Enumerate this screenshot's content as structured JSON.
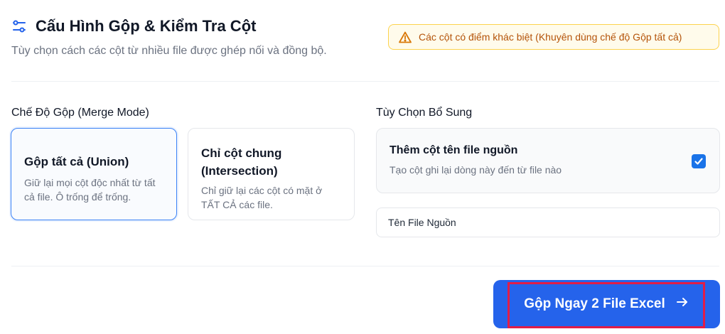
{
  "header": {
    "title": "Cấu Hình Gộp & Kiểm Tra Cột",
    "subtitle": "Tùy chọn cách các cột từ nhiều file được ghép nối và đồng bộ.",
    "warning": "Các cột có điểm khác biệt (Khuyên dùng chế độ Gộp tất cả)",
    "icons": {
      "title": "sliders-icon",
      "warning": "warning-triangle-icon"
    }
  },
  "merge_mode": {
    "label": "Chế Độ Gộp (Merge Mode)",
    "options": [
      {
        "title": "Gộp tất cả (Union)",
        "desc": "Giữ lại mọi cột độc nhất từ tất cả file. Ô trống để trống.",
        "selected": true
      },
      {
        "title": "Chỉ cột chung (Intersection)",
        "desc": "Chỉ giữ lại các cột có mặt ở TẤT CẢ các file.",
        "selected": false
      }
    ]
  },
  "extra_options": {
    "label": "Tùy Chọn Bổ Sung",
    "source_column": {
      "title": "Thêm cột tên file nguồn",
      "desc": "Tạo cột ghi lại dòng này đến từ file nào",
      "checked": true
    },
    "source_name_input": {
      "value": "Tên File Nguồn"
    }
  },
  "action": {
    "button_label": "Gộp Ngay 2 File Excel",
    "icon": "arrow-right-icon"
  },
  "colors": {
    "primary": "#2563eb",
    "warning_text": "#b45309",
    "warning_bg": "#fffbeb",
    "highlight": "#e11d48"
  }
}
